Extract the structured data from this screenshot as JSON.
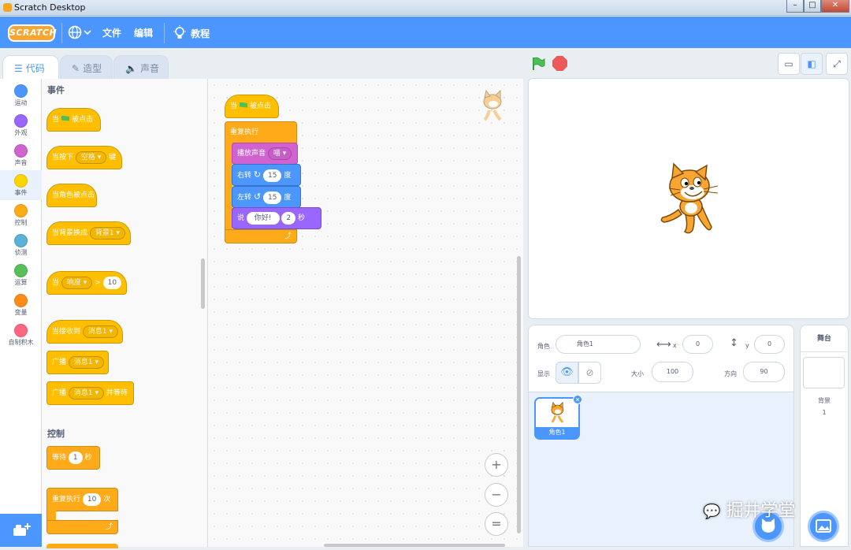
{
  "window": {
    "title": "Scratch Desktop"
  },
  "menubar": {
    "logo": "SCRATCH",
    "file": "文件",
    "edit": "编辑",
    "tutorials": "教程"
  },
  "tabs": [
    {
      "label": "代码",
      "icon": "code-icon",
      "active": true
    },
    {
      "label": "造型",
      "icon": "brush-icon",
      "active": false
    },
    {
      "label": "声音",
      "icon": "speaker-icon",
      "active": false
    }
  ],
  "categories": [
    {
      "label": "运动",
      "color": "#4c97ff"
    },
    {
      "label": "外观",
      "color": "#9966ff"
    },
    {
      "label": "声音",
      "color": "#cf63cf"
    },
    {
      "label": "事件",
      "color": "#ffd500",
      "selected": true
    },
    {
      "label": "控制",
      "color": "#ffab19"
    },
    {
      "label": "侦测",
      "color": "#5cb1d6"
    },
    {
      "label": "运算",
      "color": "#59c059"
    },
    {
      "label": "变量",
      "color": "#ff8c1a"
    },
    {
      "label": "自制积木",
      "color": "#ff6680"
    }
  ],
  "palette": {
    "events_header": "事件",
    "when_flag": {
      "pre": "当",
      "post": "被点击"
    },
    "when_key": {
      "pre": "当按下",
      "key": "空格",
      "post": "键"
    },
    "when_sprite_clicked": "当角色被点击",
    "when_backdrop": {
      "pre": "当背景换成",
      "backdrop": "背景1"
    },
    "when_greater": {
      "pre": "当",
      "sensor": "响度",
      "op": ">",
      "value": "10"
    },
    "when_receive": {
      "pre": "当接收到",
      "msg": "消息1"
    },
    "broadcast": {
      "pre": "广播",
      "msg": "消息1"
    },
    "broadcast_wait": {
      "pre": "广播",
      "msg": "消息1",
      "post": "并等待"
    },
    "control_header": "控制",
    "wait": {
      "pre": "等待",
      "value": "1",
      "post": "秒"
    },
    "repeat": {
      "pre": "重复执行",
      "value": "10",
      "post": "次"
    }
  },
  "script": {
    "hat": {
      "pre": "当",
      "post": "被点击"
    },
    "forever": "重复执行",
    "play_sound": {
      "pre": "播放声音",
      "sound": "喵"
    },
    "turn_right": {
      "pre": "右转",
      "value": "15",
      "post": "度"
    },
    "turn_left": {
      "pre": "左转",
      "value": "15",
      "post": "度"
    },
    "say": {
      "pre": "说",
      "text": "你好!",
      "secs": "2",
      "post": "秒"
    }
  },
  "zoom": {
    "in": "+",
    "out": "−",
    "reset": "="
  },
  "sprite_info": {
    "sprite_label": "角色",
    "sprite_name": "角色1",
    "x_label": "x",
    "x": "0",
    "y_label": "y",
    "y": "0",
    "show_label": "显示",
    "size_label": "大小",
    "size": "100",
    "direction_label": "方向",
    "direction": "90"
  },
  "sprite_list": [
    {
      "name": "角色1"
    }
  ],
  "stage_pane": {
    "header": "舞台",
    "backdrops_label": "背景",
    "backdrops_count": "1"
  },
  "watermark": "掘井学堂"
}
